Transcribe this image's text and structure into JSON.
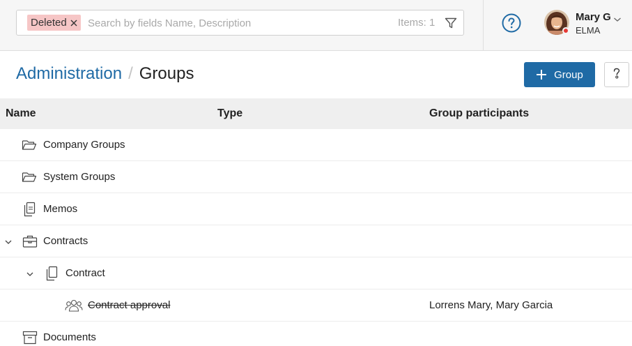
{
  "search": {
    "chip_label": "Deleted",
    "placeholder": "Search by fields Name, Description",
    "items_count": "Items: 1"
  },
  "user": {
    "name": "Mary G",
    "org": "ELMA"
  },
  "breadcrumb": {
    "parent": "Administration",
    "separator": "/",
    "current": "Groups"
  },
  "toolbar": {
    "add_label": "Group"
  },
  "table": {
    "columns": [
      "Name",
      "Type",
      "Group participants"
    ],
    "rows": [
      {
        "name": "Company Groups",
        "icon": "folder-open-icon",
        "participants": "",
        "deleted": false
      },
      {
        "name": "System Groups",
        "icon": "folder-open-icon",
        "participants": "",
        "deleted": false
      },
      {
        "name": "Memos",
        "icon": "copy-documents-icon",
        "participants": "",
        "deleted": false
      },
      {
        "name": "Contracts",
        "icon": "briefcase-icon",
        "participants": "",
        "deleted": false,
        "expanded": true
      },
      {
        "name": "Contract",
        "icon": "copy-documents-icon",
        "participants": "",
        "deleted": false,
        "expanded": true
      },
      {
        "name": "Contract approval",
        "icon": "group-users-icon",
        "participants": "Lorrens Mary, Mary Garcia",
        "deleted": true
      },
      {
        "name": "Documents",
        "icon": "archive-box-icon",
        "participants": "",
        "deleted": false
      }
    ]
  },
  "colors": {
    "brand": "#1f6aa5",
    "chip_bg": "#f6c6c6",
    "status_dot": "#e53935",
    "header_bg": "#efefef"
  }
}
